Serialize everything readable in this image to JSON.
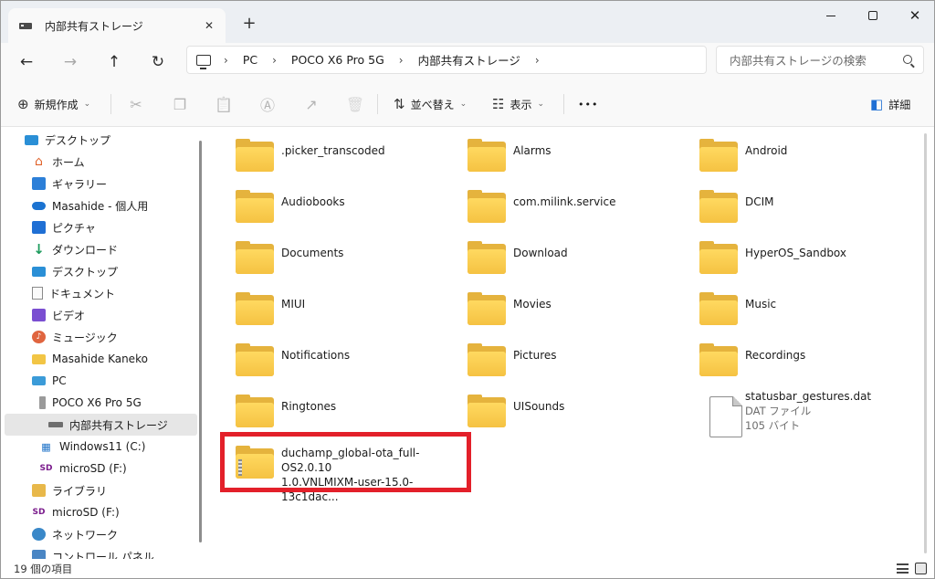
{
  "window": {
    "tab_title": "内部共有ストレージ",
    "new_tab": "+",
    "close_tab": "✕",
    "close_window": "✕"
  },
  "nav": {
    "back": "←",
    "forward": "→",
    "up": "↑",
    "refresh": "↻",
    "breadcrumbs": [
      "PC",
      "POCO X6 Pro 5G",
      "内部共有ストレージ"
    ],
    "sep": "›",
    "search_placeholder": "内部共有ストレージの検索"
  },
  "toolbar": {
    "new_label": "新規作成",
    "new_icon": "⊕",
    "cut_icon": "✂",
    "copy_icon": "❐",
    "paste_icon": "📋",
    "rename_icon": "Ⓐ",
    "share_icon": "↗",
    "delete_icon": "🗑",
    "sort_label": "並べ替え",
    "sort_icon": "⇅",
    "view_label": "表示",
    "view_icon": "☷",
    "more": "•••",
    "details_label": "詳細",
    "details_icon": "◧",
    "caret": "⌄"
  },
  "sidebar": {
    "items": [
      {
        "label": "デスクトップ",
        "icon": "desktop-icon"
      },
      {
        "label": "ホーム",
        "icon": "home-icon"
      },
      {
        "label": "ギャラリー",
        "icon": "gallery-icon"
      },
      {
        "label": "Masahide - 個人用",
        "icon": "onedrive-icon"
      },
      {
        "label": "ピクチャ",
        "icon": "pictures-icon"
      },
      {
        "label": "ダウンロード",
        "icon": "download-icon"
      },
      {
        "label": "デスクトップ",
        "icon": "desktop-icon"
      },
      {
        "label": "ドキュメント",
        "icon": "documents-icon"
      },
      {
        "label": "ビデオ",
        "icon": "videos-icon"
      },
      {
        "label": "ミュージック",
        "icon": "music-icon"
      },
      {
        "label": "Masahide Kaneko",
        "icon": "user-folder-icon"
      },
      {
        "label": "PC",
        "icon": "pc-icon"
      },
      {
        "label": "POCO X6 Pro 5G",
        "icon": "phone-icon"
      },
      {
        "label": "内部共有ストレージ",
        "icon": "drive-icon"
      },
      {
        "label": "Windows11 (C:)",
        "icon": "windows-drive-icon"
      },
      {
        "label": "microSD (F:)",
        "icon": "sd-card-icon"
      },
      {
        "label": "ライブラリ",
        "icon": "library-icon"
      },
      {
        "label": "microSD (F:)",
        "icon": "sd-card-icon"
      },
      {
        "label": "ネットワーク",
        "icon": "network-icon"
      },
      {
        "label": "コントロール パネル",
        "icon": "control-panel-icon"
      }
    ],
    "home_glyph": "⌂",
    "down_glyph": "↓",
    "music_glyph": "♪",
    "win_glyph": "▦",
    "sd_glyph": "SD"
  },
  "files": [
    {
      "name": ".picker_transcoded",
      "type": "folder"
    },
    {
      "name": "Alarms",
      "type": "folder"
    },
    {
      "name": "Android",
      "type": "folder"
    },
    {
      "name": "Audiobooks",
      "type": "folder"
    },
    {
      "name": "com.milink.service",
      "type": "folder"
    },
    {
      "name": "DCIM",
      "type": "folder"
    },
    {
      "name": "Documents",
      "type": "folder"
    },
    {
      "name": "Download",
      "type": "folder"
    },
    {
      "name": "HyperOS_Sandbox",
      "type": "folder"
    },
    {
      "name": "MIUI",
      "type": "folder"
    },
    {
      "name": "Movies",
      "type": "folder"
    },
    {
      "name": "Music",
      "type": "folder"
    },
    {
      "name": "Notifications",
      "type": "folder"
    },
    {
      "name": "Pictures",
      "type": "folder"
    },
    {
      "name": "Recordings",
      "type": "folder"
    },
    {
      "name": "Ringtones",
      "type": "folder"
    },
    {
      "name": "UISounds",
      "type": "folder"
    },
    {
      "name": "statusbar_gestures.dat",
      "type": "file",
      "kind": "DAT ファイル",
      "size": "105 バイト"
    },
    {
      "name_line1": "duchamp_global-ota_full-OS2.0.10",
      "name_line2": "1.0.VNLMIXM-user-15.0-13c1dac...",
      "type": "zip"
    }
  ],
  "status": {
    "count": "19 個の項目"
  }
}
